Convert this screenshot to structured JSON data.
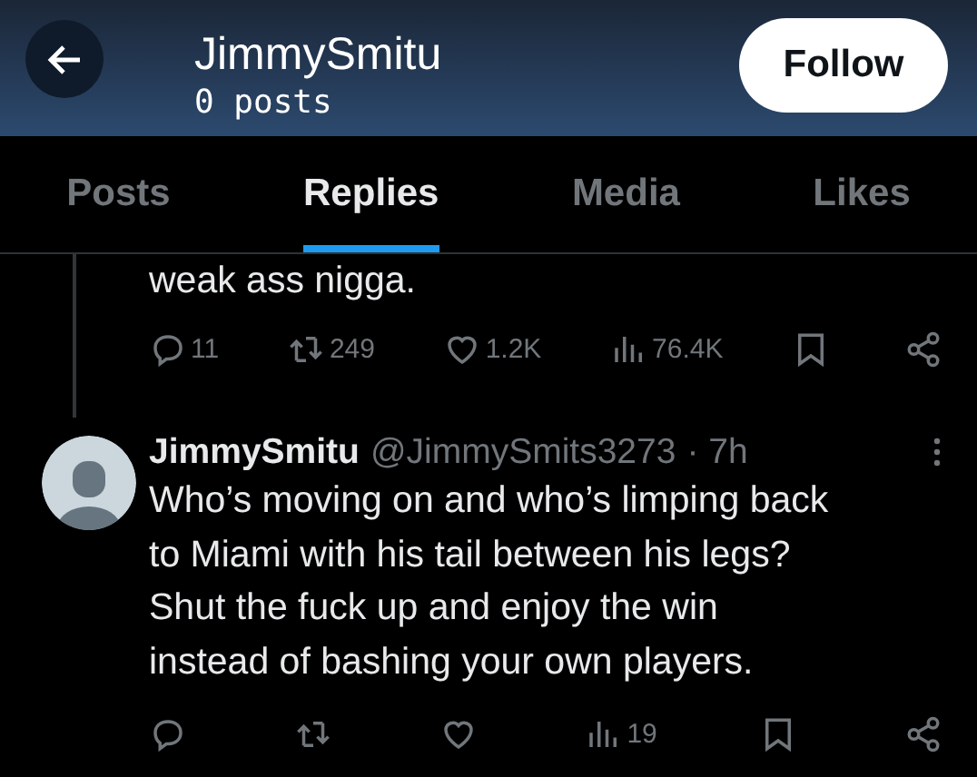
{
  "header": {
    "title": "JimmySmitu",
    "subtitle": "0 posts",
    "follow_button": "Follow"
  },
  "tabs": [
    {
      "label": "Posts",
      "selected": false
    },
    {
      "label": "Replies",
      "selected": true
    },
    {
      "label": "Media",
      "selected": false
    },
    {
      "label": "Likes",
      "selected": false
    }
  ],
  "posts": [
    {
      "thread_line": true,
      "text": "weak ass nigga.",
      "actions": [
        {
          "kind": "reply",
          "count": "11"
        },
        {
          "kind": "repost",
          "count": "249"
        },
        {
          "kind": "like",
          "count": "1.2K"
        },
        {
          "kind": "views",
          "count": "76.4K"
        },
        {
          "kind": "bookmark"
        },
        {
          "kind": "share"
        }
      ]
    },
    {
      "thread_line": false,
      "author": "JimmySmitu",
      "handle": "@JimmySmits3273",
      "time": "· 7h",
      "text": "Who’s moving on and who’s limping back\nto Miami with his tail between his legs?\nShut the fuck up and enjoy the win\ninstead of bashing your own players.",
      "actions": [
        {
          "kind": "reply"
        },
        {
          "kind": "repost"
        },
        {
          "kind": "like"
        },
        {
          "kind": "views",
          "count": "19"
        },
        {
          "kind": "bookmark"
        },
        {
          "kind": "share"
        }
      ]
    }
  ]
}
